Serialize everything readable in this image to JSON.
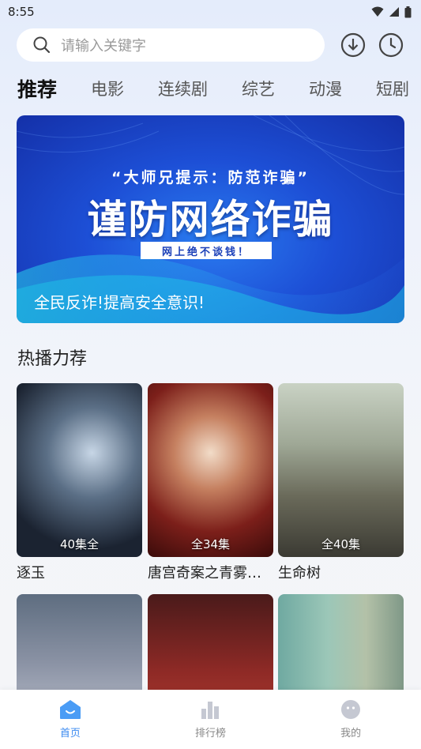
{
  "status_bar": {
    "time": "8:55"
  },
  "search": {
    "placeholder": "请输入关键字"
  },
  "tabs": [
    "推荐",
    "电影",
    "连续剧",
    "综艺",
    "动漫",
    "短剧"
  ],
  "banner": {
    "quote": "“大师兄提示：防范诈骗”",
    "title": "谨防网络诈骗",
    "tag": "网上绝不谈钱！",
    "slogan": "全民反诈!提高安全意识!"
  },
  "section": {
    "title": "热播力荐"
  },
  "cards": [
    {
      "title": "逐玉",
      "badge": "40集全"
    },
    {
      "title": "唐宫奇案之青雾风鸣",
      "badge": "全34集"
    },
    {
      "title": "生命树",
      "badge": "全40集"
    },
    {
      "title": "",
      "badge": ""
    },
    {
      "title": "",
      "badge": ""
    },
    {
      "title": "",
      "badge": ""
    }
  ],
  "bottom_nav": [
    {
      "label": "首页",
      "icon": "home-icon",
      "active": true
    },
    {
      "label": "排行榜",
      "icon": "chart-icon",
      "active": false
    },
    {
      "label": "我的",
      "icon": "profile-icon",
      "active": false
    }
  ],
  "colors": {
    "accent": "#3b8af0",
    "banner": "#1d4fd6"
  }
}
